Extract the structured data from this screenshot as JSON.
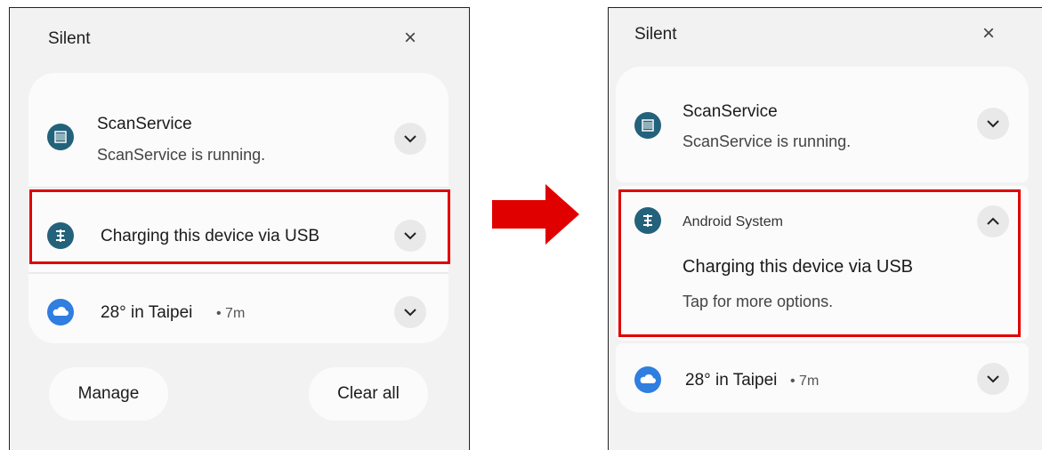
{
  "left": {
    "header": {
      "title": "Silent",
      "close_glyph": "×"
    },
    "notifications": [
      {
        "app": "ScanService",
        "title": "ScanService",
        "text": "ScanService is running.",
        "icon": "scanner-icon"
      },
      {
        "app": "usb",
        "title": "Charging this device via USB",
        "icon": "usb-icon"
      },
      {
        "app": "weather",
        "title": "28° in Taipei",
        "meta": "• 7m",
        "icon": "cloud-icon"
      }
    ],
    "buttons": {
      "manage": "Manage",
      "clear_all": "Clear all"
    }
  },
  "right": {
    "header": {
      "title": "Silent",
      "close_glyph": "×"
    },
    "notifications": [
      {
        "title": "ScanService",
        "text": "ScanService is running.",
        "icon": "scanner-icon"
      },
      {
        "app_name": "Android System",
        "title": "Charging this device via USB",
        "text": "Tap for more options.",
        "icon": "usb-icon"
      },
      {
        "title": "28° in Taipei",
        "meta": "• 7m",
        "icon": "cloud-icon"
      }
    ]
  },
  "colors": {
    "highlight": "#e00000",
    "arrow": "#e00000",
    "teal_icon": "#23627a",
    "weather_icon": "#2f7ee0"
  }
}
